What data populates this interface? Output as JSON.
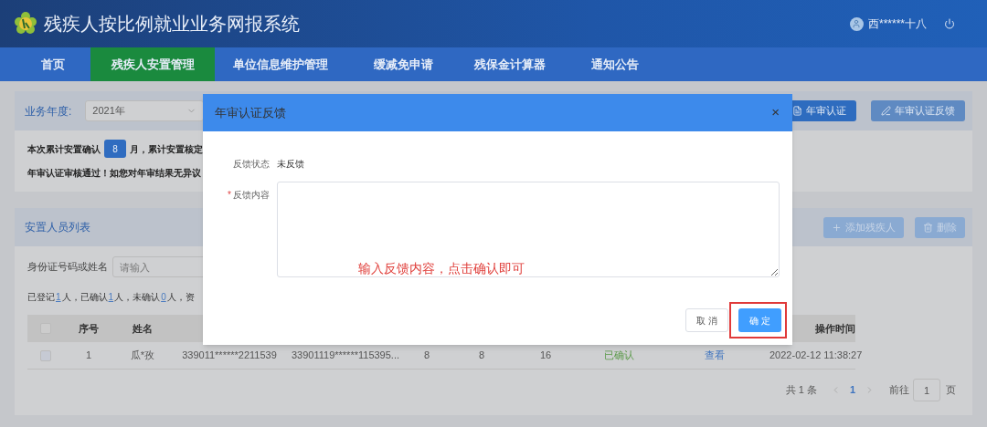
{
  "header": {
    "title": "残疾人按比例就业业务网报系统",
    "user": "西******十八"
  },
  "nav": [
    {
      "label": "首页",
      "selected": false
    },
    {
      "label": "残疾人安置管理",
      "selected": true
    },
    {
      "label": "单位信息维护管理",
      "selected": false
    },
    {
      "label": "缓减免申请",
      "selected": false
    },
    {
      "label": "残保金计算器",
      "selected": false
    },
    {
      "label": "通知公告",
      "selected": false
    }
  ],
  "year_panel": {
    "label": "业务年度:",
    "year": "2021年",
    "buttons": [
      "年审认证",
      "年审认证反馈"
    ],
    "summary_before": "本次累计安置确认",
    "summary_count": "8",
    "summary_after": "月，累计安置核定",
    "notice": "年审认证审核通过！如您对年审结果无异议"
  },
  "list_panel": {
    "title": "安置人员列表",
    "buttons": [
      "添加残疾人",
      "删除"
    ],
    "search_label": "身份证号码或姓名",
    "search_placeholder": "请输入",
    "stats": [
      {
        "text": "已登记",
        "kind": "label"
      },
      {
        "text": "1",
        "kind": "link"
      },
      {
        "text": "人，已确认",
        "kind": "label"
      },
      {
        "text": "1",
        "kind": "link"
      },
      {
        "text": "人，未确认",
        "kind": "label"
      },
      {
        "text": "0",
        "kind": "link"
      },
      {
        "text": "人，资",
        "kind": "label"
      }
    ],
    "table": {
      "header_checked": false,
      "columns": [
        "序号",
        "姓名",
        "",
        "",
        "",
        "",
        "",
        "",
        "",
        "操作时间"
      ],
      "rows": [
        {
          "checked": false,
          "cells": [
            "1",
            "瓜*孜",
            "339011******2211539",
            "33901119******115395...",
            "8",
            "8",
            "16",
            "已确认",
            "查看",
            "2022-02-12 11:38:27"
          ]
        }
      ]
    },
    "pagination": {
      "total": "共 1 条",
      "current": "1",
      "goto_label": "前往",
      "goto_value": "1",
      "page_unit": "页"
    }
  },
  "dialog": {
    "title": "年审认证反馈",
    "close": "×",
    "status_label": "反馈状态",
    "status_value": "未反馈",
    "required_mark": "*",
    "content_label": "反馈内容",
    "annotation": "输入反馈内容，点击确认即可",
    "buttons": [
      {
        "label": "取 消",
        "kind": "default"
      },
      {
        "label": "确 定",
        "kind": "primary",
        "highlighted": true
      }
    ]
  }
}
